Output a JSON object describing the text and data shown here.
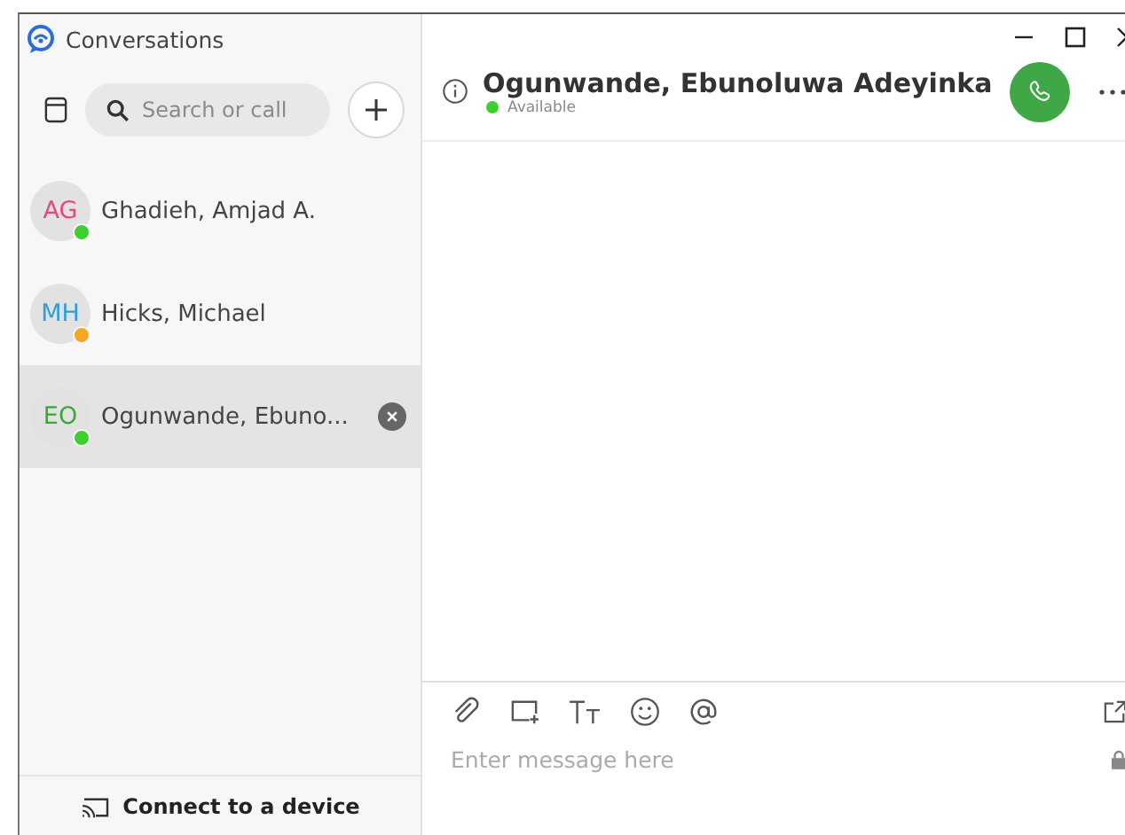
{
  "app": {
    "title": "Conversations"
  },
  "search": {
    "placeholder": "Search or call"
  },
  "conversations": [
    {
      "avatar": {
        "initials": "AG",
        "color": "#e4497f"
      },
      "name": "Ghadieh, Amjad A.",
      "presence": {
        "color": "#3ccf2f"
      },
      "selected": false
    },
    {
      "avatar": {
        "initials": "MH",
        "color": "#2f9fdc"
      },
      "name": "Hicks, Michael",
      "presence": {
        "color": "#f5a623"
      },
      "selected": false
    },
    {
      "avatar": {
        "initials": "EO",
        "color": "#3aa83a"
      },
      "name": "Ogunwande, Ebuno...",
      "presence": {
        "color": "#3ccf2f"
      },
      "selected": true
    }
  ],
  "connect_button": "Connect to a device",
  "chat": {
    "name": "Ogunwande, Ebunoluwa Adeyinka",
    "presence": {
      "color": "#3ccf2f"
    },
    "status": "Available"
  },
  "composer": {
    "placeholder": "Enter message here"
  }
}
